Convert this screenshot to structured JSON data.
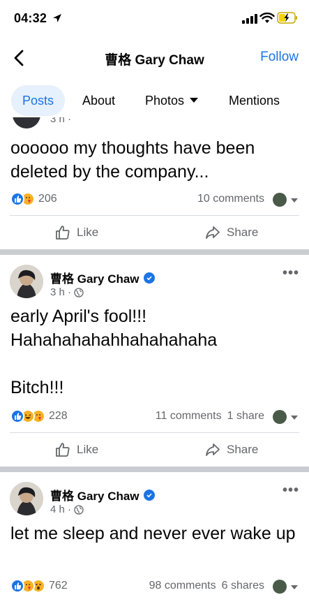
{
  "status_bar": {
    "time": "04:32"
  },
  "header": {
    "title": "曹格 Gary Chaw",
    "follow_label": "Follow"
  },
  "tabs": [
    {
      "label": "Posts",
      "active": true
    },
    {
      "label": "About"
    },
    {
      "label": "Photos",
      "has_dropdown": true
    },
    {
      "label": "Mentions"
    }
  ],
  "posts": [
    {
      "time": "3 h · ",
      "text": "oooooo my thoughts have been deleted by the company...",
      "reaction_count": "206",
      "comments": "10 comments",
      "shares": "",
      "reactions": [
        "like",
        "care"
      ],
      "like_label": "Like",
      "share_label": "Share"
    },
    {
      "author": "曹格 Gary Chaw",
      "time": "3 h · ",
      "text": "early April's fool!!!\nHahahahahahhahahahaha\n\nBitch!!!",
      "reaction_count": "228",
      "comments": "11 comments",
      "shares": "1 share",
      "reactions": [
        "like",
        "haha",
        "care"
      ],
      "like_label": "Like",
      "share_label": "Share"
    },
    {
      "author": "曹格 Gary Chaw",
      "time": "4 h · ",
      "text": "let me sleep and never ever wake up",
      "reaction_count": "762",
      "comments": "98 comments",
      "shares": "6 shares",
      "reactions": [
        "like",
        "care",
        "wow"
      ]
    }
  ],
  "colors": {
    "accent": "#1b74e4",
    "secondary_text": "#65676b",
    "separator": "#c9ccd1"
  }
}
